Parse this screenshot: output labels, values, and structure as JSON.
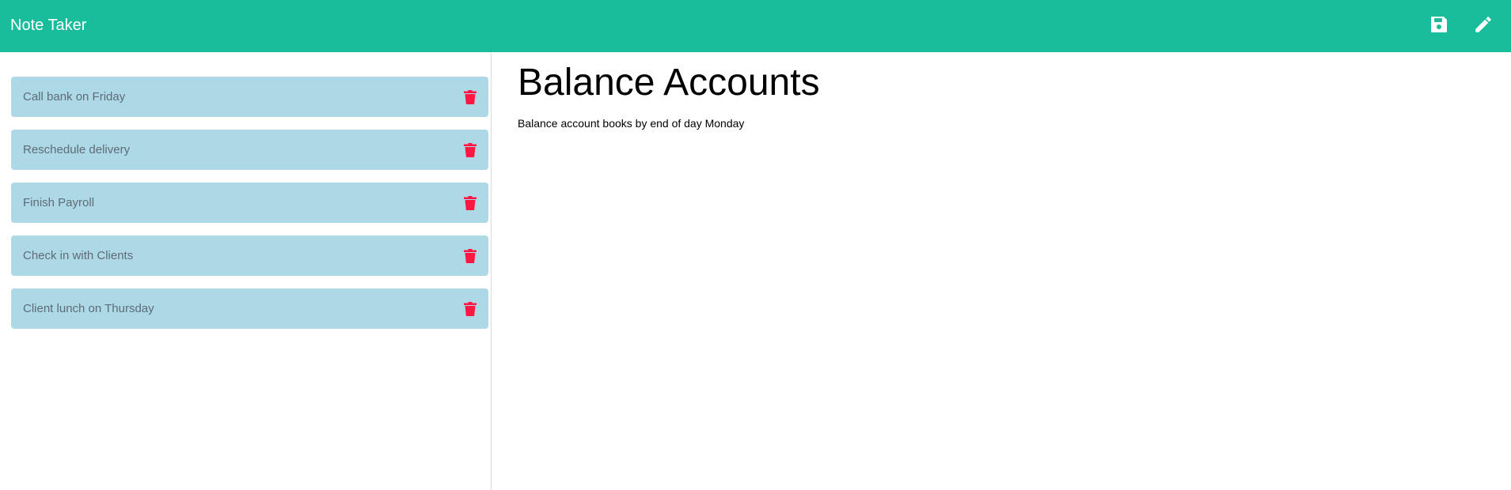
{
  "app": {
    "title": "Note Taker",
    "accent_color": "#19bd9b"
  },
  "toolbar": {
    "save_icon": "save-icon",
    "edit_icon": "pencil-icon"
  },
  "notes": [
    {
      "title": "Call bank on Friday",
      "delete_icon": "trash-icon"
    },
    {
      "title": "Reschedule delivery",
      "delete_icon": "trash-icon"
    },
    {
      "title": "Finish Payroll",
      "delete_icon": "trash-icon"
    },
    {
      "title": "Check in with Clients",
      "delete_icon": "trash-icon"
    },
    {
      "title": "Client lunch on Thursday",
      "delete_icon": "trash-icon"
    }
  ],
  "active_note": {
    "title": "Balance Accounts",
    "text": "Balance account books by end of day Monday"
  },
  "colors": {
    "note_item_bg": "#add8e6",
    "delete_icon": "#ff1744"
  }
}
